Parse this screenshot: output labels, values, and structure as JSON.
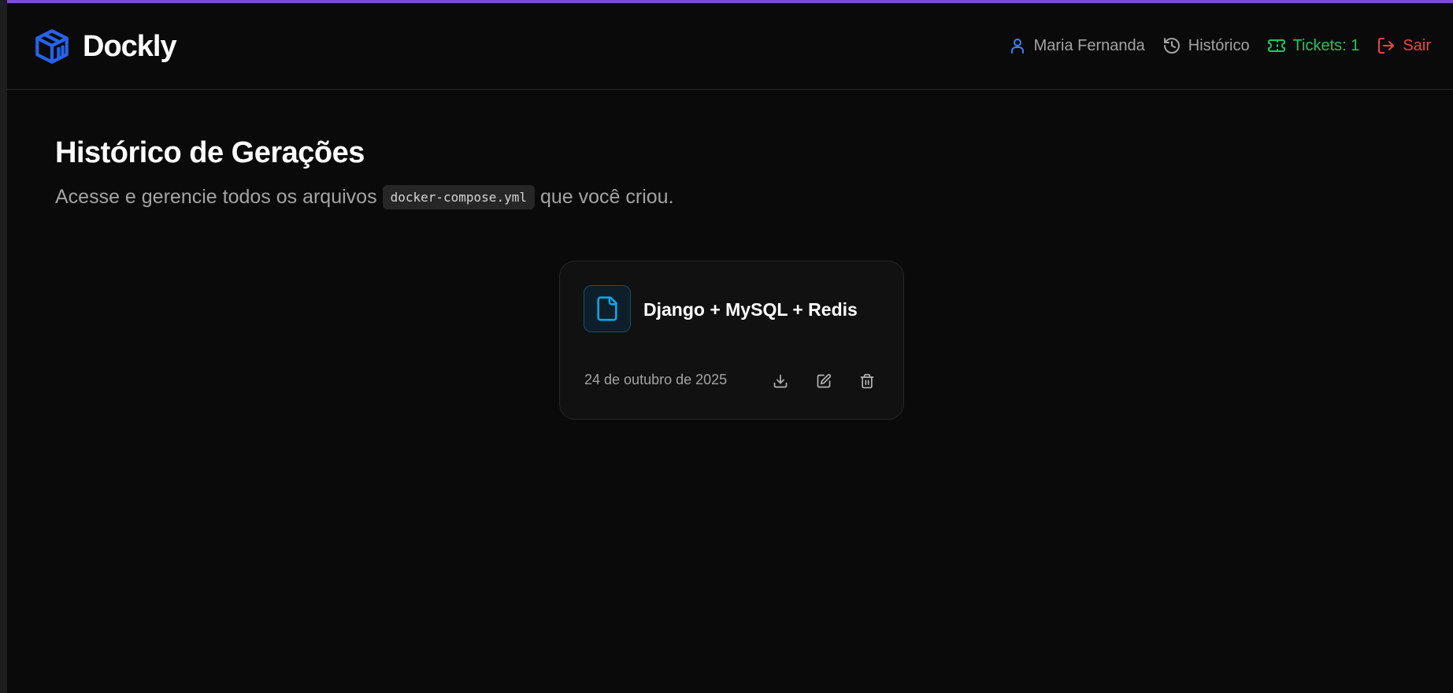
{
  "app": {
    "name": "Dockly",
    "brand_color": "#2563eb",
    "accent_bar_color": "#7c4dcf"
  },
  "nav": {
    "user_name": "Maria Fernanda",
    "user_icon": "user-icon",
    "history_label": "Histórico",
    "history_icon": "history-icon",
    "tickets_label": "Tickets: 1",
    "tickets_icon": "ticket-icon",
    "logout_label": "Sair",
    "logout_icon": "logout-icon",
    "colors": {
      "tickets": "#22c55e",
      "logout": "#ef4444",
      "user_icon": "#3b82f6"
    }
  },
  "page": {
    "title": "Histórico de Gerações",
    "subtitle_before": "Acesse e gerencie todos os arquivos",
    "subtitle_code": "docker-compose.yml",
    "subtitle_after": "que você criou."
  },
  "generations": [
    {
      "title": "Django + MySQL + Redis",
      "date": "24 de outubro de 2025",
      "icon": "file-icon",
      "icon_color": "#0ea5e9",
      "actions": [
        "download-icon",
        "edit-icon",
        "trash-icon"
      ]
    }
  ]
}
